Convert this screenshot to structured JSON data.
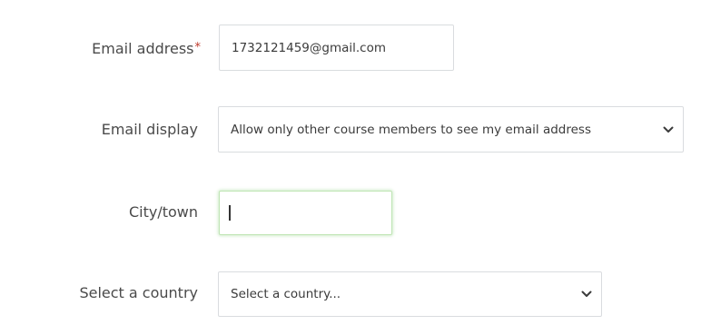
{
  "email": {
    "label": "Email address",
    "required_marker": "*",
    "value": "1732121459@gmail.com"
  },
  "email_display": {
    "label": "Email display",
    "selected": "Allow only other course members to see my email address"
  },
  "city": {
    "label": "City/town",
    "value": ""
  },
  "country": {
    "label": "Select a country",
    "selected": "Select a country..."
  },
  "icons": {
    "dropdown": "chevron-down-icon",
    "required": "asterisk"
  },
  "colors": {
    "required_marker": "#c0392b",
    "focus_border": "#bfe5b4"
  }
}
